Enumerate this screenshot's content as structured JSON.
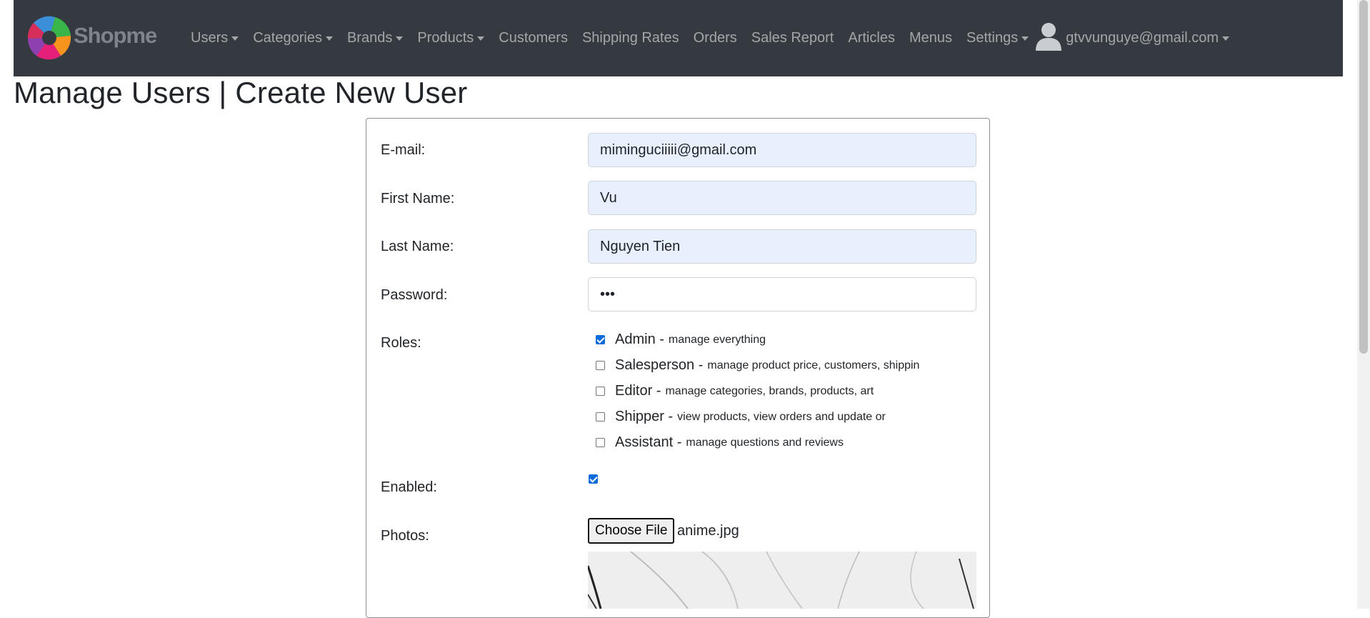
{
  "nav": {
    "brand": "Shopme",
    "items": [
      {
        "label": "Users",
        "dropdown": true
      },
      {
        "label": "Categories",
        "dropdown": true
      },
      {
        "label": "Brands",
        "dropdown": true
      },
      {
        "label": "Products",
        "dropdown": true
      },
      {
        "label": "Customers",
        "dropdown": false
      },
      {
        "label": "Shipping Rates",
        "dropdown": false
      },
      {
        "label": "Orders",
        "dropdown": false
      },
      {
        "label": "Sales Report",
        "dropdown": false
      },
      {
        "label": "Articles",
        "dropdown": false
      },
      {
        "label": "Menus",
        "dropdown": false
      },
      {
        "label": "Settings",
        "dropdown": true
      }
    ],
    "user_email": "gtvvunguye@gmail.com"
  },
  "page": {
    "title": "Manage Users | Create New User"
  },
  "form": {
    "email_label": "E-mail:",
    "email_value": "miminguciiiii@gmail.com",
    "first_name_label": "First Name:",
    "first_name_value": "Vu",
    "last_name_label": "Last Name:",
    "last_name_value": "Nguyen Tien",
    "password_label": "Password:",
    "password_value": "•••",
    "roles_label": "Roles:",
    "roles": [
      {
        "name": "Admin",
        "desc": "manage everything",
        "checked": true
      },
      {
        "name": "Salesperson",
        "desc": "manage product price, customers, shippin",
        "checked": false
      },
      {
        "name": "Editor",
        "desc": "manage categories, brands, products, art",
        "checked": false
      },
      {
        "name": "Shipper",
        "desc": "view products, view orders and update or",
        "checked": false
      },
      {
        "name": "Assistant",
        "desc": "manage questions and reviews",
        "checked": false
      }
    ],
    "enabled_label": "Enabled:",
    "enabled_checked": true,
    "photos_label": "Photos:",
    "choose_file_label": "Choose File",
    "file_name": "anime.jpg"
  },
  "colors": {
    "navbar_bg": "#343a40",
    "input_autofill_bg": "#e8f0fe",
    "checkbox_checked": "#0b6cda"
  }
}
